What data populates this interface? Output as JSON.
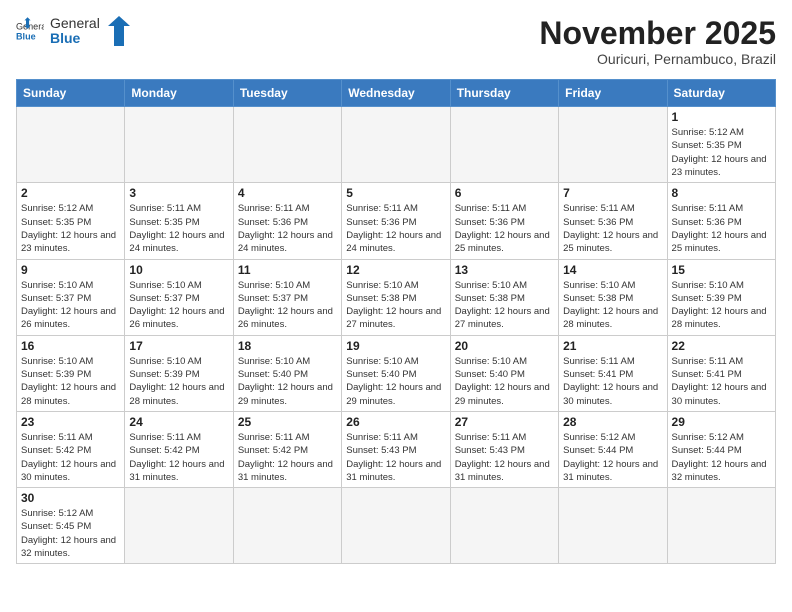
{
  "header": {
    "logo_general": "General",
    "logo_blue": "Blue",
    "month_title": "November 2025",
    "location": "Ouricuri, Pernambuco, Brazil"
  },
  "days_of_week": [
    "Sunday",
    "Monday",
    "Tuesday",
    "Wednesday",
    "Thursday",
    "Friday",
    "Saturday"
  ],
  "weeks": [
    [
      {
        "day": "",
        "info": ""
      },
      {
        "day": "",
        "info": ""
      },
      {
        "day": "",
        "info": ""
      },
      {
        "day": "",
        "info": ""
      },
      {
        "day": "",
        "info": ""
      },
      {
        "day": "",
        "info": ""
      },
      {
        "day": "1",
        "info": "Sunrise: 5:12 AM\nSunset: 5:35 PM\nDaylight: 12 hours and 23 minutes."
      }
    ],
    [
      {
        "day": "2",
        "info": "Sunrise: 5:12 AM\nSunset: 5:35 PM\nDaylight: 12 hours and 23 minutes."
      },
      {
        "day": "3",
        "info": "Sunrise: 5:11 AM\nSunset: 5:35 PM\nDaylight: 12 hours and 24 minutes."
      },
      {
        "day": "4",
        "info": "Sunrise: 5:11 AM\nSunset: 5:36 PM\nDaylight: 12 hours and 24 minutes."
      },
      {
        "day": "5",
        "info": "Sunrise: 5:11 AM\nSunset: 5:36 PM\nDaylight: 12 hours and 24 minutes."
      },
      {
        "day": "6",
        "info": "Sunrise: 5:11 AM\nSunset: 5:36 PM\nDaylight: 12 hours and 25 minutes."
      },
      {
        "day": "7",
        "info": "Sunrise: 5:11 AM\nSunset: 5:36 PM\nDaylight: 12 hours and 25 minutes."
      },
      {
        "day": "8",
        "info": "Sunrise: 5:11 AM\nSunset: 5:36 PM\nDaylight: 12 hours and 25 minutes."
      }
    ],
    [
      {
        "day": "9",
        "info": "Sunrise: 5:10 AM\nSunset: 5:37 PM\nDaylight: 12 hours and 26 minutes."
      },
      {
        "day": "10",
        "info": "Sunrise: 5:10 AM\nSunset: 5:37 PM\nDaylight: 12 hours and 26 minutes."
      },
      {
        "day": "11",
        "info": "Sunrise: 5:10 AM\nSunset: 5:37 PM\nDaylight: 12 hours and 26 minutes."
      },
      {
        "day": "12",
        "info": "Sunrise: 5:10 AM\nSunset: 5:38 PM\nDaylight: 12 hours and 27 minutes."
      },
      {
        "day": "13",
        "info": "Sunrise: 5:10 AM\nSunset: 5:38 PM\nDaylight: 12 hours and 27 minutes."
      },
      {
        "day": "14",
        "info": "Sunrise: 5:10 AM\nSunset: 5:38 PM\nDaylight: 12 hours and 28 minutes."
      },
      {
        "day": "15",
        "info": "Sunrise: 5:10 AM\nSunset: 5:39 PM\nDaylight: 12 hours and 28 minutes."
      }
    ],
    [
      {
        "day": "16",
        "info": "Sunrise: 5:10 AM\nSunset: 5:39 PM\nDaylight: 12 hours and 28 minutes."
      },
      {
        "day": "17",
        "info": "Sunrise: 5:10 AM\nSunset: 5:39 PM\nDaylight: 12 hours and 28 minutes."
      },
      {
        "day": "18",
        "info": "Sunrise: 5:10 AM\nSunset: 5:40 PM\nDaylight: 12 hours and 29 minutes."
      },
      {
        "day": "19",
        "info": "Sunrise: 5:10 AM\nSunset: 5:40 PM\nDaylight: 12 hours and 29 minutes."
      },
      {
        "day": "20",
        "info": "Sunrise: 5:10 AM\nSunset: 5:40 PM\nDaylight: 12 hours and 29 minutes."
      },
      {
        "day": "21",
        "info": "Sunrise: 5:11 AM\nSunset: 5:41 PM\nDaylight: 12 hours and 30 minutes."
      },
      {
        "day": "22",
        "info": "Sunrise: 5:11 AM\nSunset: 5:41 PM\nDaylight: 12 hours and 30 minutes."
      }
    ],
    [
      {
        "day": "23",
        "info": "Sunrise: 5:11 AM\nSunset: 5:42 PM\nDaylight: 12 hours and 30 minutes."
      },
      {
        "day": "24",
        "info": "Sunrise: 5:11 AM\nSunset: 5:42 PM\nDaylight: 12 hours and 31 minutes."
      },
      {
        "day": "25",
        "info": "Sunrise: 5:11 AM\nSunset: 5:42 PM\nDaylight: 12 hours and 31 minutes."
      },
      {
        "day": "26",
        "info": "Sunrise: 5:11 AM\nSunset: 5:43 PM\nDaylight: 12 hours and 31 minutes."
      },
      {
        "day": "27",
        "info": "Sunrise: 5:11 AM\nSunset: 5:43 PM\nDaylight: 12 hours and 31 minutes."
      },
      {
        "day": "28",
        "info": "Sunrise: 5:12 AM\nSunset: 5:44 PM\nDaylight: 12 hours and 31 minutes."
      },
      {
        "day": "29",
        "info": "Sunrise: 5:12 AM\nSunset: 5:44 PM\nDaylight: 12 hours and 32 minutes."
      }
    ],
    [
      {
        "day": "30",
        "info": "Sunrise: 5:12 AM\nSunset: 5:45 PM\nDaylight: 12 hours and 32 minutes."
      },
      {
        "day": "",
        "info": ""
      },
      {
        "day": "",
        "info": ""
      },
      {
        "day": "",
        "info": ""
      },
      {
        "day": "",
        "info": ""
      },
      {
        "day": "",
        "info": ""
      },
      {
        "day": "",
        "info": ""
      }
    ]
  ]
}
